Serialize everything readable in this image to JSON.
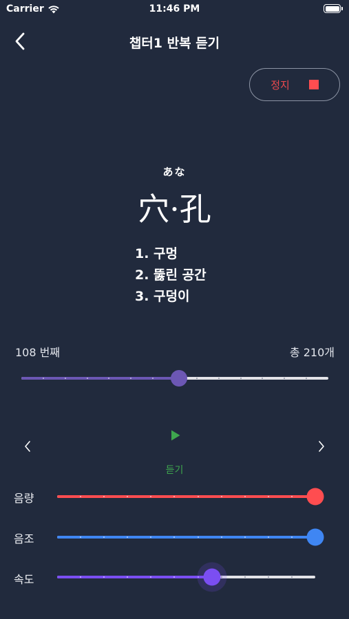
{
  "status_bar": {
    "carrier": "Carrier",
    "time": "11:46 PM",
    "wifi_icon": "wifi-icon",
    "battery_icon": "battery-icon"
  },
  "header": {
    "back_icon": "chevron-left-icon",
    "title": "챕터1 반복 듣기"
  },
  "stop_button": {
    "label": "정지",
    "icon": "stop-square-icon",
    "color": "#ff4d50"
  },
  "word": {
    "reading": "あな",
    "kanji": "穴·孔",
    "meanings": [
      "1. 구멍",
      "2. 뚫린 공간",
      "3. 구덩이"
    ]
  },
  "progress": {
    "current_label": "108 번째",
    "total_label": "총 210개",
    "current": 108,
    "total": 210,
    "fill_color": "#6c57b4"
  },
  "playback": {
    "prev_icon": "chevron-left-icon",
    "play_icon": "play-icon",
    "next_icon": "chevron-right-icon",
    "play_label": "듣기",
    "play_color": "#3ea64e"
  },
  "controls": {
    "volume": {
      "label": "음량",
      "value": 1.0,
      "color": "#ff4d50"
    },
    "pitch": {
      "label": "음조",
      "value": 1.0,
      "color": "#3f86f3"
    },
    "speed": {
      "label": "속도",
      "value": 0.6,
      "color": "#7b4ef2"
    }
  }
}
